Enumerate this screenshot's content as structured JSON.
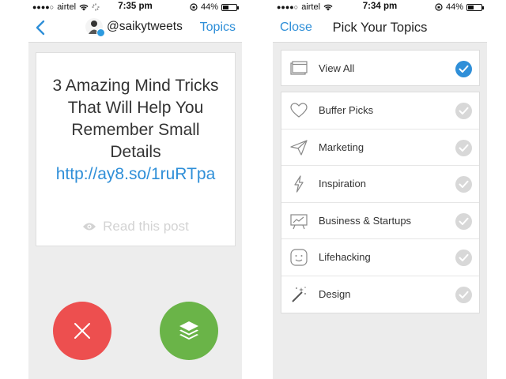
{
  "left_screen": {
    "status_bar": {
      "carrier": "airtel",
      "time": "7:35 pm",
      "battery": "44%",
      "battery_level": 0.44
    },
    "nav": {
      "handle": "@saikytweets",
      "topics_link": "Topics"
    },
    "post": {
      "title_text": "3 Amazing Mind Tricks That Will Help You Remember Small Details ",
      "link_text": "http://ay8.so/1ruRTpa",
      "read_label": "Read this post"
    },
    "colors": {
      "dismiss": "#ed4f4f",
      "add": "#6ab448",
      "link": "#2f8fd8"
    }
  },
  "right_screen": {
    "status_bar": {
      "carrier": "airtel",
      "time": "7:34 pm",
      "battery": "44%",
      "battery_level": 0.44
    },
    "nav": {
      "close_link": "Close",
      "title": "Pick Your Topics"
    },
    "view_all": {
      "label": "View All",
      "icon": "window-icon",
      "checked": true
    },
    "topics": [
      {
        "label": "Buffer Picks",
        "icon": "heart-icon",
        "checked": false
      },
      {
        "label": "Marketing",
        "icon": "paper-plane-icon",
        "checked": false
      },
      {
        "label": "Inspiration",
        "icon": "lightning-icon",
        "checked": false
      },
      {
        "label": "Business & Startups",
        "icon": "chart-board-icon",
        "checked": false
      },
      {
        "label": "Lifehacking",
        "icon": "smiley-icon",
        "checked": false
      },
      {
        "label": "Design",
        "icon": "magic-wand-icon",
        "checked": false
      }
    ]
  }
}
